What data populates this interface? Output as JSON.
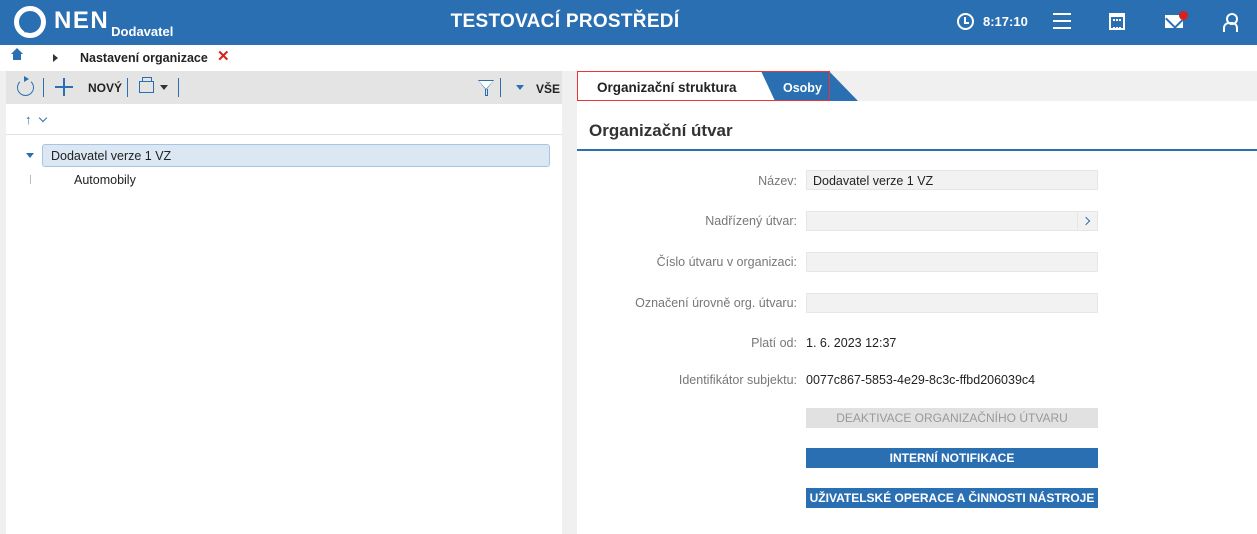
{
  "header": {
    "logo_text": "NEN",
    "logo_sub": "Dodavatel",
    "env_title": "TESTOVACÍ PROSTŘEDÍ",
    "clock": "8:17:10",
    "icons": [
      "clock-icon",
      "menu-icon",
      "calendar-icon",
      "mail-icon",
      "user-icon"
    ],
    "notification_dot_color": "#d9201e",
    "accent_color": "#2b6fb3"
  },
  "breadcrumb": {
    "current": "Nastavení organizace"
  },
  "toolbar": {
    "new_label": "NOVÝ",
    "all_label": "VŠE"
  },
  "tree": {
    "root": "Dodavatel verze 1 VZ",
    "children": [
      "Automobily"
    ]
  },
  "tabs": [
    {
      "label": "Organizační struktura",
      "active": true
    },
    {
      "label": "Osoby",
      "active": false
    }
  ],
  "panel": {
    "title": "Organizační útvar",
    "fields": {
      "nazev": {
        "label": "Název:",
        "value": "Dodavatel verze 1 VZ"
      },
      "nadrizeny": {
        "label": "Nadřízený útvar:",
        "value": ""
      },
      "cislo": {
        "label": "Číslo útvaru v organizaci:",
        "value": ""
      },
      "oznaceni": {
        "label": "Označení úrovně org. útvaru:",
        "value": ""
      },
      "plati_od": {
        "label": "Platí od:",
        "value": "1. 6. 2023 12:37"
      },
      "identifikator": {
        "label": "Identifikátor subjektu:",
        "value": "0077c867-5853-4e29-8c3c-ffbd206039c4"
      }
    },
    "buttons": {
      "deactivate": "DEAKTIVACE ORGANIZAČNÍHO ÚTVARU",
      "notify": "INTERNÍ NOTIFIKACE",
      "operations": "UŽIVATELSKÉ OPERACE A ČINNOSTI NÁSTROJE"
    }
  }
}
